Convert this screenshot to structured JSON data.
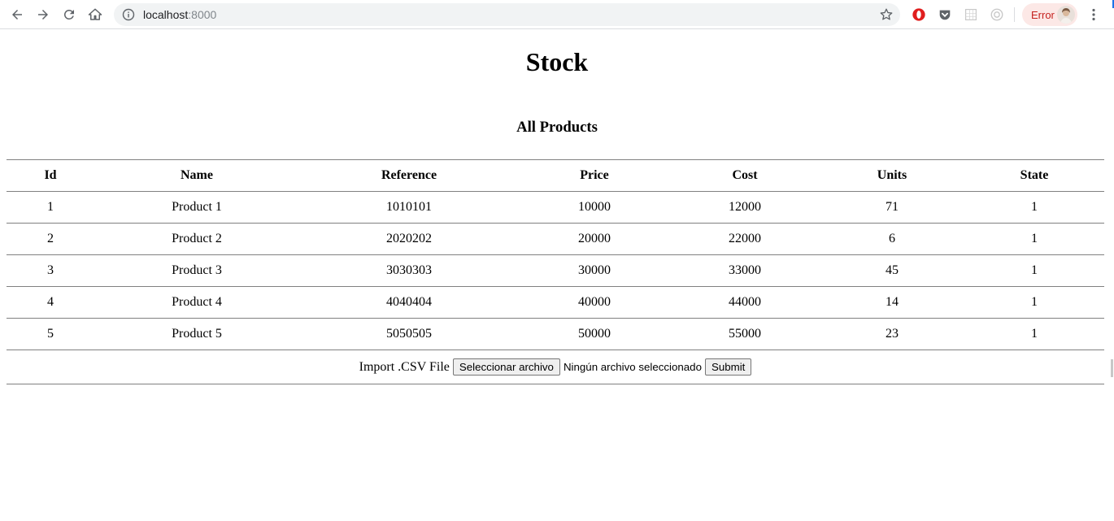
{
  "browser": {
    "url_host": "localhost",
    "url_port": ":8000",
    "error_label": "Error"
  },
  "page": {
    "title": "Stock",
    "section_title": "All Products"
  },
  "table": {
    "headers": [
      "Id",
      "Name",
      "Reference",
      "Price",
      "Cost",
      "Units",
      "State"
    ],
    "rows": [
      [
        "1",
        "Product 1",
        "1010101",
        "10000",
        "12000",
        "71",
        "1"
      ],
      [
        "2",
        "Product 2",
        "2020202",
        "20000",
        "22000",
        "6",
        "1"
      ],
      [
        "3",
        "Product 3",
        "3030303",
        "30000",
        "33000",
        "45",
        "1"
      ],
      [
        "4",
        "Product 4",
        "4040404",
        "40000",
        "44000",
        "14",
        "1"
      ],
      [
        "5",
        "Product 5",
        "5050505",
        "50000",
        "55000",
        "23",
        "1"
      ]
    ]
  },
  "import_form": {
    "label": "Import .CSV File",
    "choose_file_label": "Seleccionar archivo",
    "file_status": "Ningún archivo seleccionado",
    "submit_label": "Submit"
  },
  "icons": {
    "back": "back-arrow-icon",
    "forward": "forward-arrow-icon",
    "reload": "reload-icon",
    "home": "home-icon",
    "info": "info-icon",
    "bookmark": "star-icon",
    "menu": "kebab-menu-icon"
  },
  "colors": {
    "error_chip_bg": "#fce8e6",
    "error_text": "#c5221f",
    "table_border": "#808080"
  }
}
